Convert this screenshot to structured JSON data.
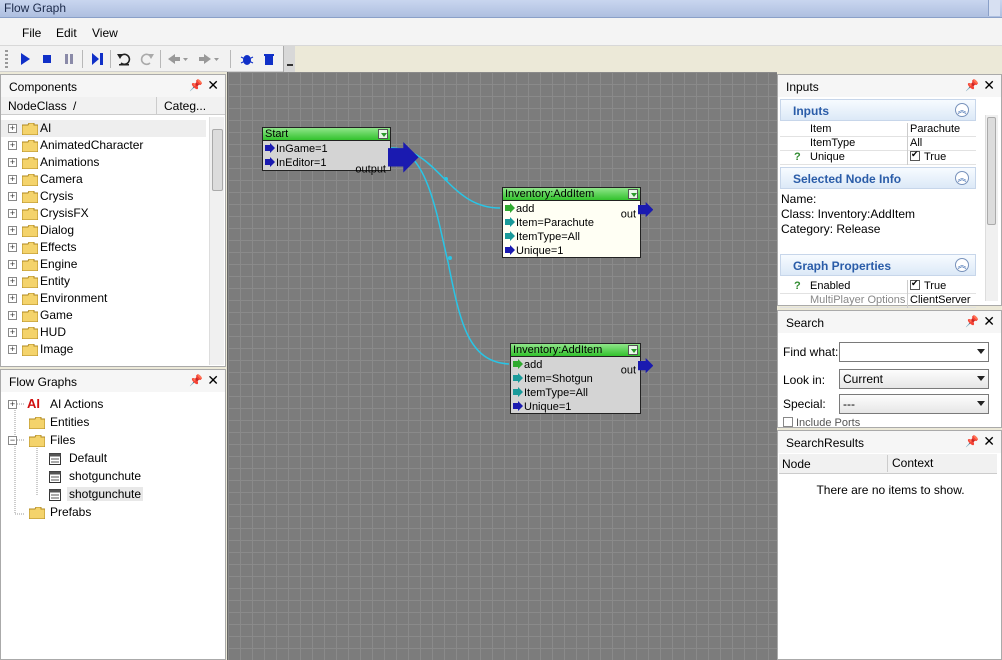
{
  "window": {
    "title": "Flow Graph"
  },
  "menu": {
    "file": "File",
    "edit": "Edit",
    "view": "View"
  },
  "toolbar": {
    "icons": [
      "play-icon",
      "stop-icon",
      "pause-icon",
      "step-icon",
      "undo-icon",
      "redo-icon",
      "back-icon",
      "forward-icon",
      "debug-icon",
      "delete-icon"
    ]
  },
  "components": {
    "title": "Components",
    "col_nodeclass": "NodeClass",
    "col_sort": "/",
    "col_category": "Categ...",
    "items": [
      "AI",
      "AnimatedCharacter",
      "Animations",
      "Camera",
      "Crysis",
      "CrysisFX",
      "Dialog",
      "Effects",
      "Engine",
      "Entity",
      "Environment",
      "Game",
      "HUD",
      "Image"
    ]
  },
  "flowgraphs": {
    "title": "Flow Graphs",
    "ai_badge": "AI",
    "ai_actions": "AI Actions",
    "entities": "Entities",
    "files": "Files",
    "default": "Default",
    "file1": "shotgunchute",
    "file2": "shotgunchute",
    "prefabs": "Prefabs"
  },
  "graph": {
    "start": {
      "title": "Start",
      "in1": "InGame=1",
      "in2": "InEditor=1",
      "out": "output"
    },
    "node1": {
      "title": "Inventory:AddItem",
      "add": "add",
      "out": "out",
      "item": "Item=Parachute",
      "itemtype": "ItemType=All",
      "unique": "Unique=1"
    },
    "node2": {
      "title": "Inventory:AddItem",
      "add": "add",
      "out": "out",
      "item": "Item=Shotgun",
      "itemtype": "ItemType=All",
      "unique": "Unique=1"
    }
  },
  "inputs": {
    "title": "Inputs",
    "section": "Inputs",
    "rows": [
      {
        "k": "Item",
        "v": "Parachute"
      },
      {
        "k": "ItemType",
        "v": "All"
      },
      {
        "q": "?",
        "k": "Unique",
        "v": "True"
      }
    ],
    "selected_title": "Selected Node Info",
    "name_line": "Name:",
    "class_line": "Class: Inventory:AddItem",
    "category_line": "Category: Release",
    "graph_title": "Graph Properties",
    "enabled_q": "?",
    "enabled_k": "Enabled",
    "enabled_v": "True",
    "mp_k": "MultiPlayer Options",
    "mp_v": "ClientServer"
  },
  "search": {
    "title": "Search",
    "find_label": "Find what:",
    "find_value": "",
    "lookin_label": "Look in:",
    "lookin_value": "Current",
    "special_label": "Special:",
    "special_value": "---",
    "include_label": "Include Ports"
  },
  "results": {
    "title": "SearchResults",
    "col_node": "Node",
    "col_context": "Context",
    "empty": "There are no items to show."
  },
  "colors": {
    "accent": "#2a5ca8",
    "node_header": "#32c22c",
    "link": "#29c5e6",
    "canvas": "#7c7c7c"
  }
}
